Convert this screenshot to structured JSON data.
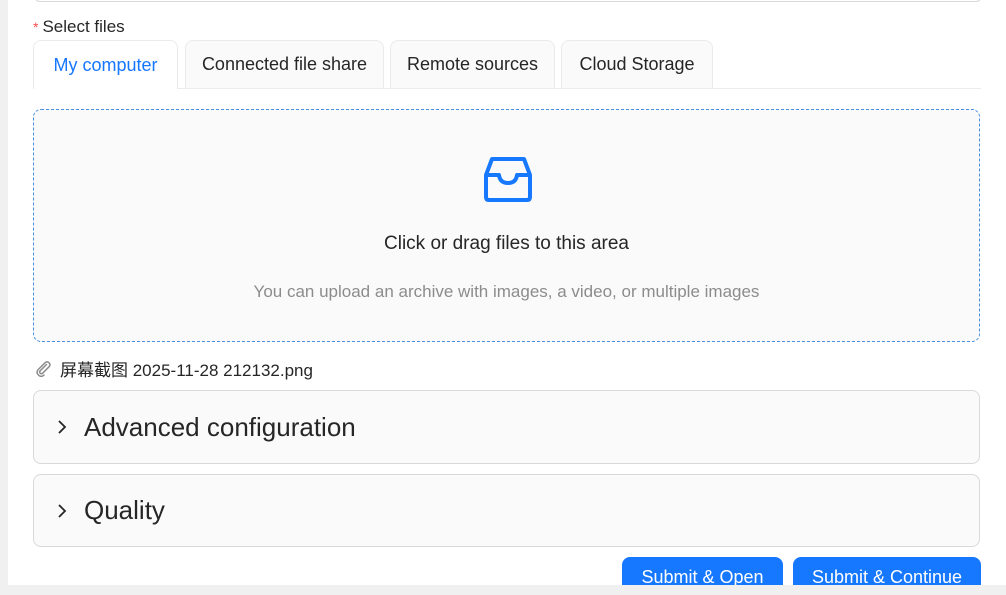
{
  "form": {
    "required_mark": "*",
    "select_files_label": "Select files"
  },
  "tabs": [
    {
      "label": "My computer",
      "active": true
    },
    {
      "label": "Connected file share",
      "active": false
    },
    {
      "label": "Remote sources",
      "active": false
    },
    {
      "label": "Cloud Storage",
      "active": false
    }
  ],
  "dropzone": {
    "icon": "inbox-icon",
    "title": "Click or drag files to this area",
    "hint": "You can upload an archive with images, a video, or multiple images"
  },
  "uploaded_file": {
    "icon": "paperclip-icon",
    "name": "屏幕截图 2025-11-28 212132.png"
  },
  "sections": [
    {
      "title": "Advanced configuration",
      "icon": "chevron-right-icon"
    },
    {
      "title": "Quality",
      "icon": "chevron-right-icon"
    }
  ],
  "actions": {
    "submit_open": "Submit & Open",
    "submit_continue": "Submit & Continue"
  },
  "colors": {
    "primary": "#1677ff",
    "required": "#ff4d4f",
    "dropzone_border": "#4a90e2"
  }
}
